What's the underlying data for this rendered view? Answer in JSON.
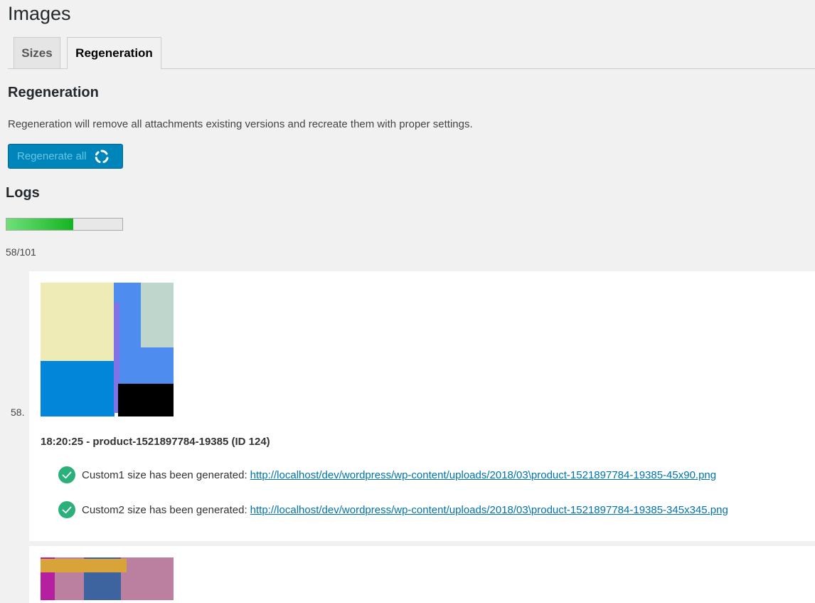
{
  "page": {
    "title": "Images"
  },
  "tabs": [
    {
      "label": "Sizes",
      "active": false
    },
    {
      "label": "Regeneration",
      "active": true
    }
  ],
  "regeneration": {
    "heading": "Regeneration",
    "description": "Regeneration will remove all attachments existing versions and recreate them with proper settings.",
    "button_label": "Regenerate all",
    "button_icon": "spinner-icon",
    "button_color": "#0085ba"
  },
  "logs": {
    "heading": "Logs",
    "progress": {
      "done": 58,
      "total": 101,
      "label": "58/101",
      "fill_color": "#14b422"
    },
    "entries": [
      {
        "number": "58.",
        "heading": "18:20:25 - product-1521897784-19385 (ID 124)",
        "lines": [
          {
            "icon": "check-circle-icon",
            "text": "Custom1 size has been generated:",
            "url": "http://localhost/dev/wordpress/wp-content/uploads/2018/03\\product-1521897784-19385-45x90.png"
          },
          {
            "icon": "check-circle-icon",
            "text": "Custom2 size has been generated:",
            "url": "http://localhost/dev/wordpress/wp-content/uploads/2018/03\\product-1521897784-19385-345x345.png"
          }
        ]
      }
    ]
  },
  "colors": {
    "accent": "#0085ba",
    "link": "#0073aa",
    "success": "#2bb07c"
  }
}
